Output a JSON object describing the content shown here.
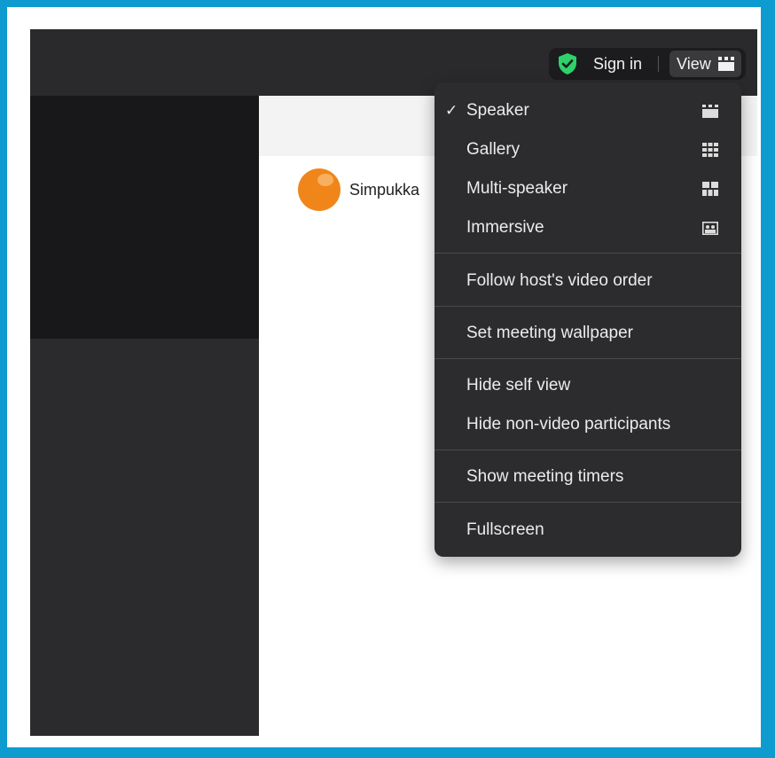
{
  "header": {
    "sign_in": "Sign in",
    "view": "View"
  },
  "participant": {
    "name": "Simpukka"
  },
  "view_menu": {
    "items": [
      {
        "label": "Speaker",
        "checked": true,
        "icon": "speaker-layout-icon"
      },
      {
        "label": "Gallery",
        "checked": false,
        "icon": "gallery-grid-icon"
      },
      {
        "label": "Multi-speaker",
        "checked": false,
        "icon": "multi-speaker-icon"
      },
      {
        "label": "Immersive",
        "checked": false,
        "icon": "immersive-icon"
      },
      {
        "label": "Follow host's video order"
      },
      {
        "label": "Set meeting wallpaper"
      },
      {
        "label": "Hide self view"
      },
      {
        "label": "Hide non-video participants"
      },
      {
        "label": "Show meeting timers"
      },
      {
        "label": "Fullscreen"
      }
    ],
    "check_mark": "✓"
  },
  "colors": {
    "frame_border": "#0e9bd0",
    "shield_green": "#2fd16a",
    "avatar_orange": "#f0861a"
  }
}
